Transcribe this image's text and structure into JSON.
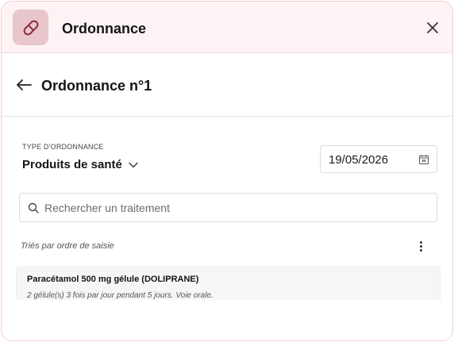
{
  "header": {
    "title": "Ordonnance",
    "icon": "pill-icon",
    "accent": "#e8c6cb",
    "background": "#fdf3f4"
  },
  "subheader": {
    "title": "Ordonnance n°1"
  },
  "form": {
    "type_label": "TYPE D'ORDONNANCE",
    "type_value": "Produits de santé",
    "date_value": "19/05/2026"
  },
  "search": {
    "placeholder": "Rechercher un traitement",
    "value": ""
  },
  "list": {
    "sort_label": "Triés par ordre de saisie",
    "items": [
      {
        "name": "Paracétamol 500 mg gélule (DOLIPRANE)",
        "detail": "2 gélule(s) 3 fois par jour pendant 5 jours. Voie orale."
      }
    ]
  }
}
